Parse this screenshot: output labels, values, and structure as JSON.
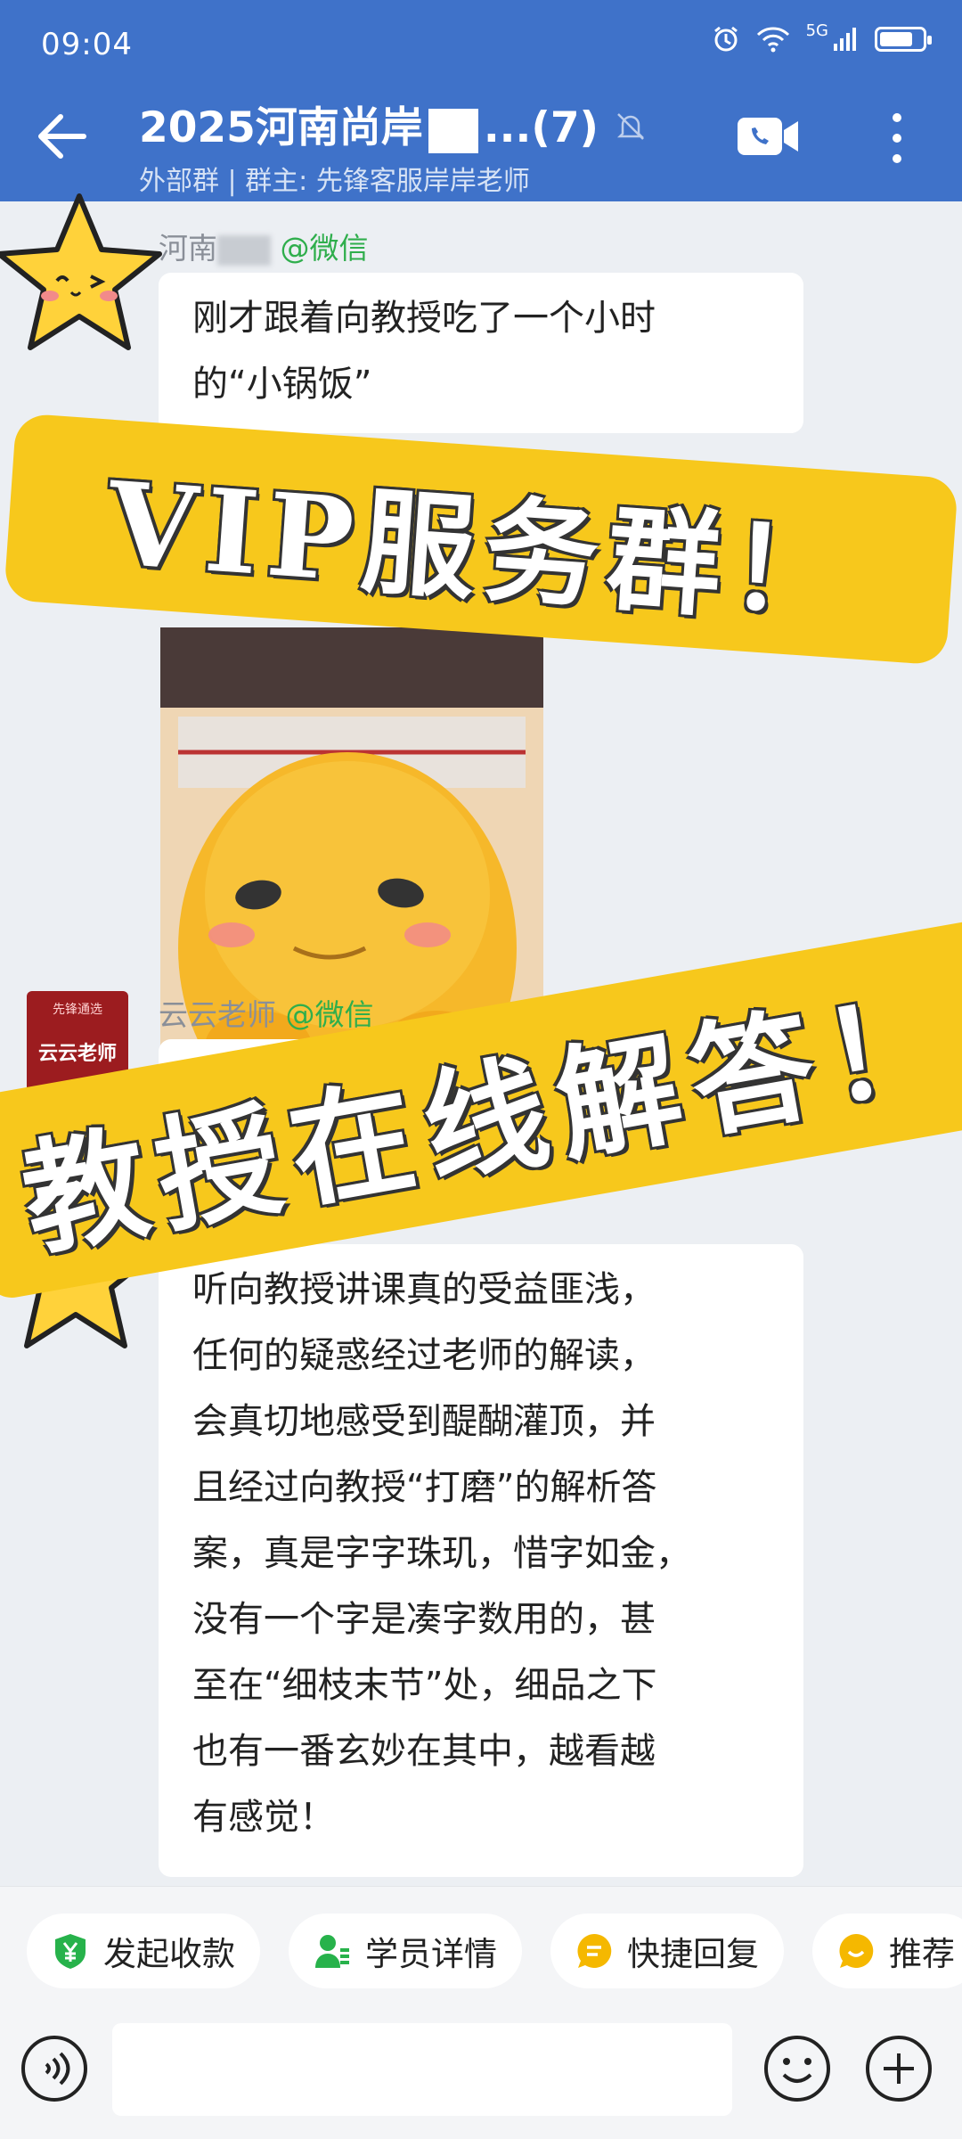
{
  "status_bar": {
    "time": "09:04",
    "network": "5G"
  },
  "header": {
    "title_prefix": "2025河南尚岸",
    "title_suffix": "...(7)",
    "subtitle": "外部群 | 群主: 先锋客服岸岸老师"
  },
  "messages": [
    {
      "sender": "河南",
      "source": "@微信",
      "text": "刚才跟着向教授吃了一个小时\n的“小锅饭”"
    },
    {
      "sender": "云云老师",
      "source": "@微信",
      "avatar_small": "先锋通选",
      "avatar_text": "云云老师"
    },
    {
      "text": "听向教授讲课真的受益匪浅，\n任何的疑惑经过老师的解读，\n会真切地感受到醍醐灌顶，并\n且经过向教授“打磨”的解析答\n案，真是字字珠玑，惜字如金，\n没有一个字是凑字数用的，甚\n至在“细枝末节”处，细品之下\n也有一番玄妙在其中，越看越\n有感觉！"
    }
  ],
  "overlays": {
    "banner1": "VIP服务群！",
    "banner2": "教授在线解答！"
  },
  "quick_actions": [
    {
      "label": "发起收款",
      "icon": "payment-icon",
      "color": "#27b24b"
    },
    {
      "label": "学员详情",
      "icon": "student-icon",
      "color": "#27b24b"
    },
    {
      "label": "快捷回复",
      "icon": "quick-reply-icon",
      "color": "#f5b800"
    },
    {
      "label": "推荐",
      "icon": "recommend-icon",
      "color": "#f5b800"
    }
  ],
  "input": {
    "placeholder": ""
  },
  "colors": {
    "header": "#3f72c9",
    "banner": "#f7c81c",
    "source": "#2fae4c"
  }
}
